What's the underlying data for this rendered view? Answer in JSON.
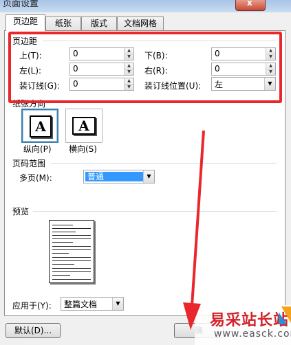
{
  "window": {
    "title": "页面设置",
    "close_symbol": "x"
  },
  "tabs": [
    {
      "label": "页边距",
      "active": true
    },
    {
      "label": "纸张",
      "active": false
    },
    {
      "label": "版式",
      "active": false
    },
    {
      "label": "文档网格",
      "active": false
    }
  ],
  "margins": {
    "group_label": "页边距",
    "top_label": "上(T):",
    "top_value": "0",
    "bottom_label": "下(B):",
    "bottom_value": "0",
    "left_label": "左(L):",
    "left_value": "0",
    "right_label": "右(R):",
    "right_value": "0",
    "gutter_label": "装订线(G):",
    "gutter_value": "0",
    "gutter_pos_label": "装订线位置(U):",
    "gutter_pos_value": "左"
  },
  "orientation": {
    "group_label": "纸张方向",
    "portrait_label": "纵向(P)",
    "landscape_label": "横向(S)",
    "icon_letter": "A"
  },
  "pages": {
    "group_label": "页码范围",
    "multi_label": "多页(M):",
    "multi_value": "普通"
  },
  "preview": {
    "group_label": "预览"
  },
  "apply": {
    "label": "应用于(Y):",
    "value": "整篇文档"
  },
  "footer": {
    "default_button": "默认(D)...",
    "ok_button": "确"
  },
  "watermark": {
    "text": "易采站长站",
    "url": "www.easck.com"
  },
  "colors": {
    "highlight": "#e8282c",
    "selection": "#3399ff",
    "accent": "#3c7fb1"
  }
}
